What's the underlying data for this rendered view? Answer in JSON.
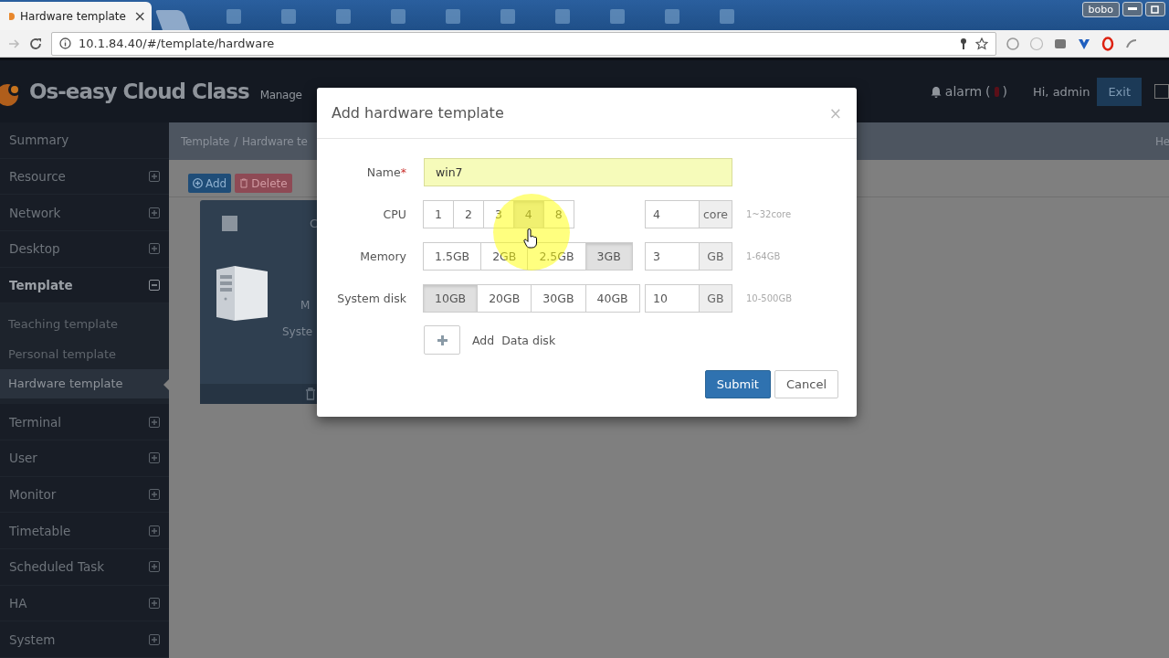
{
  "browser": {
    "tab": {
      "title": "Hardware template",
      "close": "×"
    },
    "user": "bobo",
    "url": "10.1.84.40/#/template/hardware"
  },
  "header": {
    "brand": "Os-easy Cloud Class",
    "subtitle": "Manage",
    "alarm": {
      "label": "alarm",
      "open": "(",
      "close": ")"
    },
    "greeting": "Hi, admin",
    "exit": "Exit"
  },
  "sidebar": {
    "items": [
      {
        "label": "Summary",
        "kind": "link",
        "selected": false
      },
      {
        "label": "Resource",
        "kind": "group",
        "expanded": false
      },
      {
        "label": "Network",
        "kind": "group",
        "expanded": false
      },
      {
        "label": "Desktop",
        "kind": "group",
        "expanded": false
      },
      {
        "label": "Template",
        "kind": "group",
        "expanded": true,
        "children": [
          {
            "label": "Teaching template",
            "selected": false
          },
          {
            "label": "Personal template",
            "selected": false
          },
          {
            "label": "Hardware template",
            "selected": true
          }
        ]
      },
      {
        "label": "Terminal",
        "kind": "group",
        "expanded": false
      },
      {
        "label": "User",
        "kind": "group",
        "expanded": false
      },
      {
        "label": "Monitor",
        "kind": "group",
        "expanded": false
      },
      {
        "label": "Timetable",
        "kind": "group",
        "expanded": false
      },
      {
        "label": "Scheduled Task",
        "kind": "group",
        "expanded": false
      },
      {
        "label": "HA",
        "kind": "group",
        "expanded": false
      },
      {
        "label": "System",
        "kind": "group",
        "expanded": false
      }
    ]
  },
  "breadcrumb": {
    "items": [
      "Template",
      "Hardware te"
    ],
    "separator": "/",
    "right": "He"
  },
  "toolbar": [
    {
      "label": "Add",
      "kind": "add"
    },
    {
      "label": "Delete",
      "kind": "delete"
    }
  ],
  "card": {
    "checked": false,
    "title": "C",
    "lines": [
      "M",
      "Syste"
    ]
  },
  "dialog": {
    "title": "Add hardware template",
    "close": "×",
    "fields": [
      {
        "label": "Name",
        "required_mark": "*",
        "kind": "text",
        "value": "win7"
      },
      {
        "label": "CPU",
        "kind": "choice",
        "options": [
          {
            "label": "1",
            "selected": false
          },
          {
            "label": "2",
            "selected": false
          },
          {
            "label": "3",
            "selected": false
          },
          {
            "label": "4",
            "selected": true
          },
          {
            "label": "8",
            "selected": false
          }
        ],
        "value": "4",
        "unit": "core",
        "hint": "1~32core"
      },
      {
        "label": "Memory",
        "kind": "choice",
        "options": [
          {
            "label": "1.5GB",
            "selected": false
          },
          {
            "label": "2GB",
            "selected": false
          },
          {
            "label": "2.5GB",
            "selected": false
          },
          {
            "label": "3GB",
            "selected": true
          }
        ],
        "value": "3",
        "unit": "GB",
        "hint": "1-64GB"
      },
      {
        "label": "System disk",
        "kind": "choice",
        "options": [
          {
            "label": "10GB",
            "selected": true
          },
          {
            "label": "20GB",
            "selected": false
          },
          {
            "label": "30GB",
            "selected": false
          },
          {
            "label": "40GB",
            "selected": false
          }
        ],
        "value": "10",
        "unit": "GB",
        "hint": "10-500GB"
      }
    ],
    "add_disk": "Add  Data disk",
    "buttons": [
      {
        "label": "Submit",
        "kind": "primary"
      },
      {
        "label": "Cancel",
        "kind": "default"
      }
    ]
  }
}
